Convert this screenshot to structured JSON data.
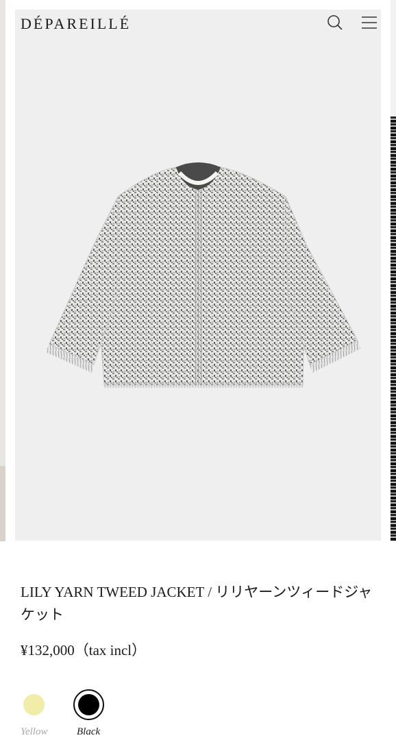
{
  "header": {
    "logo": "DÉPAREILLÉ",
    "search_icon": "search-icon",
    "menu_icon": "hamburger-menu-icon"
  },
  "product": {
    "image_icon": "tweed-jacket-image",
    "title": "LILY YARN TWEED JACKET / リリヤーンツィードジャケット",
    "price": "¥132,000（tax incl）"
  },
  "colors": {
    "options": [
      {
        "label": "Yellow",
        "hex": "#f1eda8",
        "selected": false
      },
      {
        "label": "Black",
        "hex": "#000000",
        "selected": true
      }
    ]
  }
}
